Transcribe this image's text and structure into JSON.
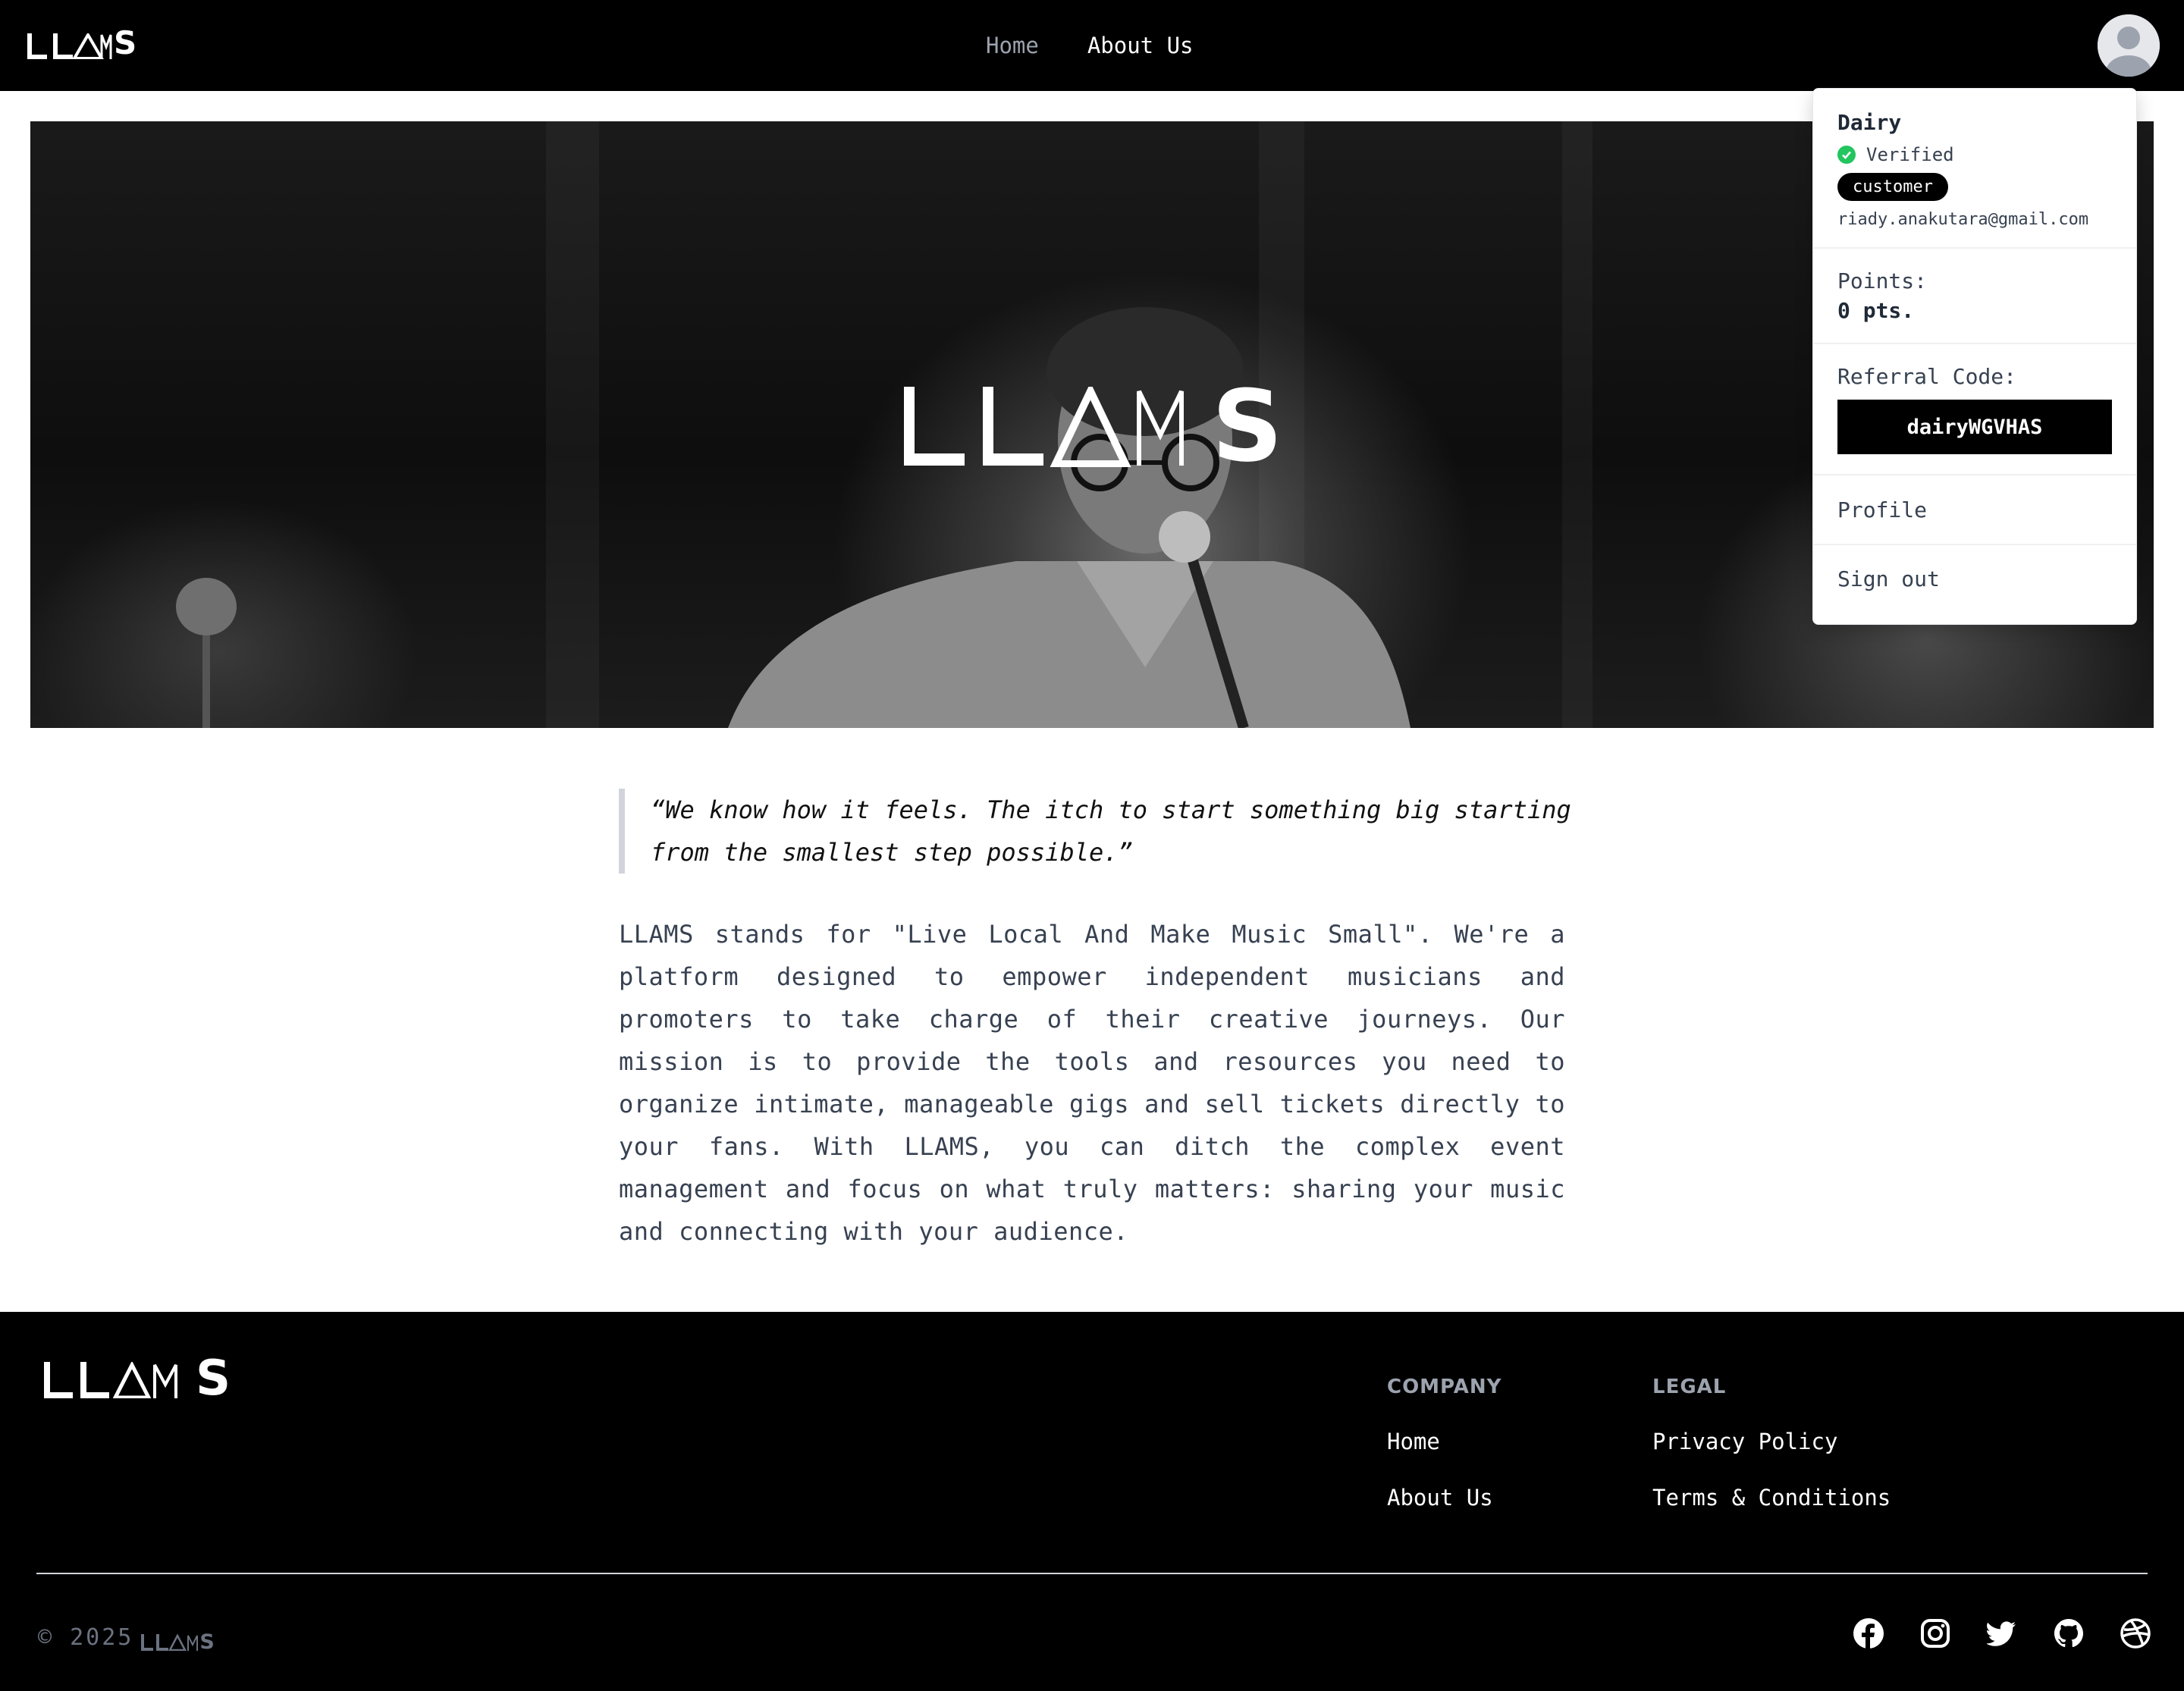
{
  "brand": {
    "logo_text": "LLAMS"
  },
  "header": {
    "nav": [
      {
        "label": "Home",
        "active": false
      },
      {
        "label": "About Us",
        "active": true
      }
    ]
  },
  "user_menu": {
    "name": "Dairy",
    "verified_label": "Verified",
    "role_badge": "customer",
    "email": "riady.anakutara@gmail.com",
    "points_label": "Points:",
    "points_value": "0 pts.",
    "referral_label": "Referral Code:",
    "referral_code": "dairyWGVHAS",
    "items": [
      "Profile",
      "Sign out"
    ]
  },
  "content": {
    "quote": "“We know how it feels. The itch to start something big starting from the smallest step possible.”",
    "body": "LLAMS stands for \"Live Local And Make Music Small\". We're a platform designed to empower independent musicians and promoters to take charge of their creative journeys. Our mission is to provide the tools and resources you need to organize intimate, manageable gigs and sell tickets directly to your fans. With LLAMS, you can ditch the complex event management and focus on what truly matters: sharing your music and connecting with your audience."
  },
  "footer": {
    "columns": [
      {
        "heading": "COMPANY",
        "links": [
          "Home",
          "About Us"
        ]
      },
      {
        "heading": "LEGAL",
        "links": [
          "Privacy Policy",
          "Terms & Conditions"
        ]
      }
    ],
    "copyright": "© 2025",
    "socials": [
      "facebook-icon",
      "instagram-icon",
      "twitter-icon",
      "github-icon",
      "dribbble-icon"
    ]
  },
  "colors": {
    "header_bg": "#000000",
    "verified": "#22c55e",
    "nav_inactive": "#9ca3af",
    "muted_text": "#6b7280"
  }
}
